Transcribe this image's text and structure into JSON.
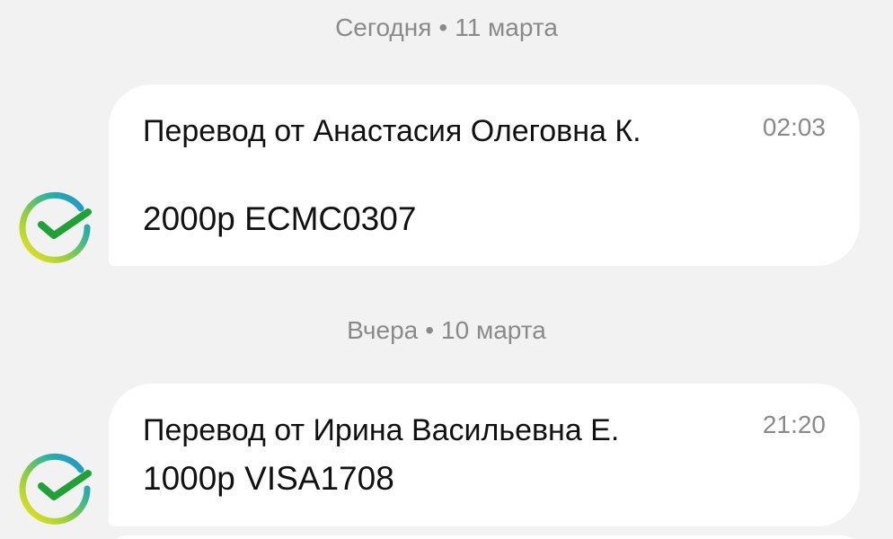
{
  "groups": [
    {
      "date_label": "Сегодня",
      "date_separator": "•",
      "date_value": "11 марта",
      "message": {
        "title": "Перевод от Анастасия Олеговна К.",
        "body": "2000р ECMC0307",
        "time": "02:03",
        "avatar_icon": "sber-check-icon"
      }
    },
    {
      "date_label": "Вчера",
      "date_separator": "•",
      "date_value": "10 марта",
      "message": {
        "title": "Перевод от Ирина Васильевна Е.",
        "body": "1000р VISA1708",
        "time": "21:20",
        "avatar_icon": "sber-check-icon"
      }
    }
  ],
  "colors": {
    "background": "#f2f2f2",
    "bubble": "#ffffff",
    "muted_text": "#8a8a8a",
    "check_green": "#21a038"
  }
}
